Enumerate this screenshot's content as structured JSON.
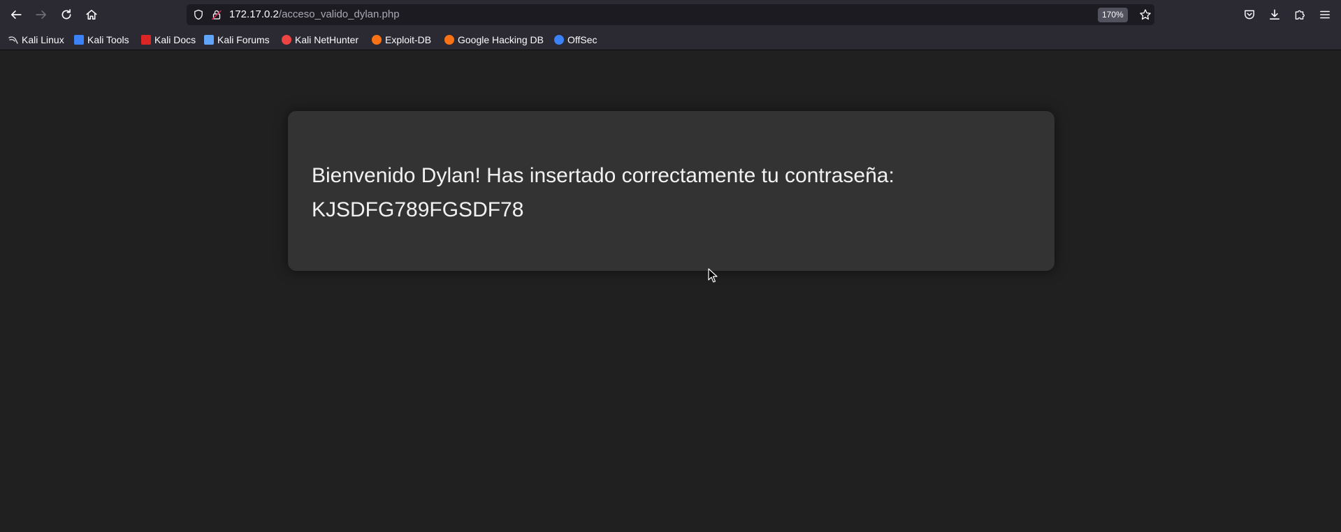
{
  "browser": {
    "url": {
      "host": "172.17.0.2",
      "path": "/acceso_valido_dylan.php"
    },
    "zoom": "170%",
    "accent": "#2b2a33"
  },
  "bookmarks": [
    {
      "label": "Kali Linux",
      "icon": "kali-dragon-icon",
      "color": "#d9d9d9"
    },
    {
      "label": "Kali Tools",
      "icon": "kali-tools-icon",
      "color": "#3b82f6"
    },
    {
      "label": "Kali Docs",
      "icon": "kali-docs-icon",
      "color": "#dc2626"
    },
    {
      "label": "Kali Forums",
      "icon": "kali-forums-icon",
      "color": "#60a5fa"
    },
    {
      "label": "Kali NetHunter",
      "icon": "kali-nethunter-icon",
      "color": "#ef4444"
    },
    {
      "label": "Exploit-DB",
      "icon": "exploit-db-icon",
      "color": "#f97316"
    },
    {
      "label": "Google Hacking DB",
      "icon": "ghdb-icon",
      "color": "#f97316"
    },
    {
      "label": "OffSec",
      "icon": "offsec-icon",
      "color": "#3b82f6"
    }
  ],
  "page": {
    "message": "Bienvenido Dylan! Has insertado correctamente tu contraseña: KJSDFG789FGSDF78"
  }
}
